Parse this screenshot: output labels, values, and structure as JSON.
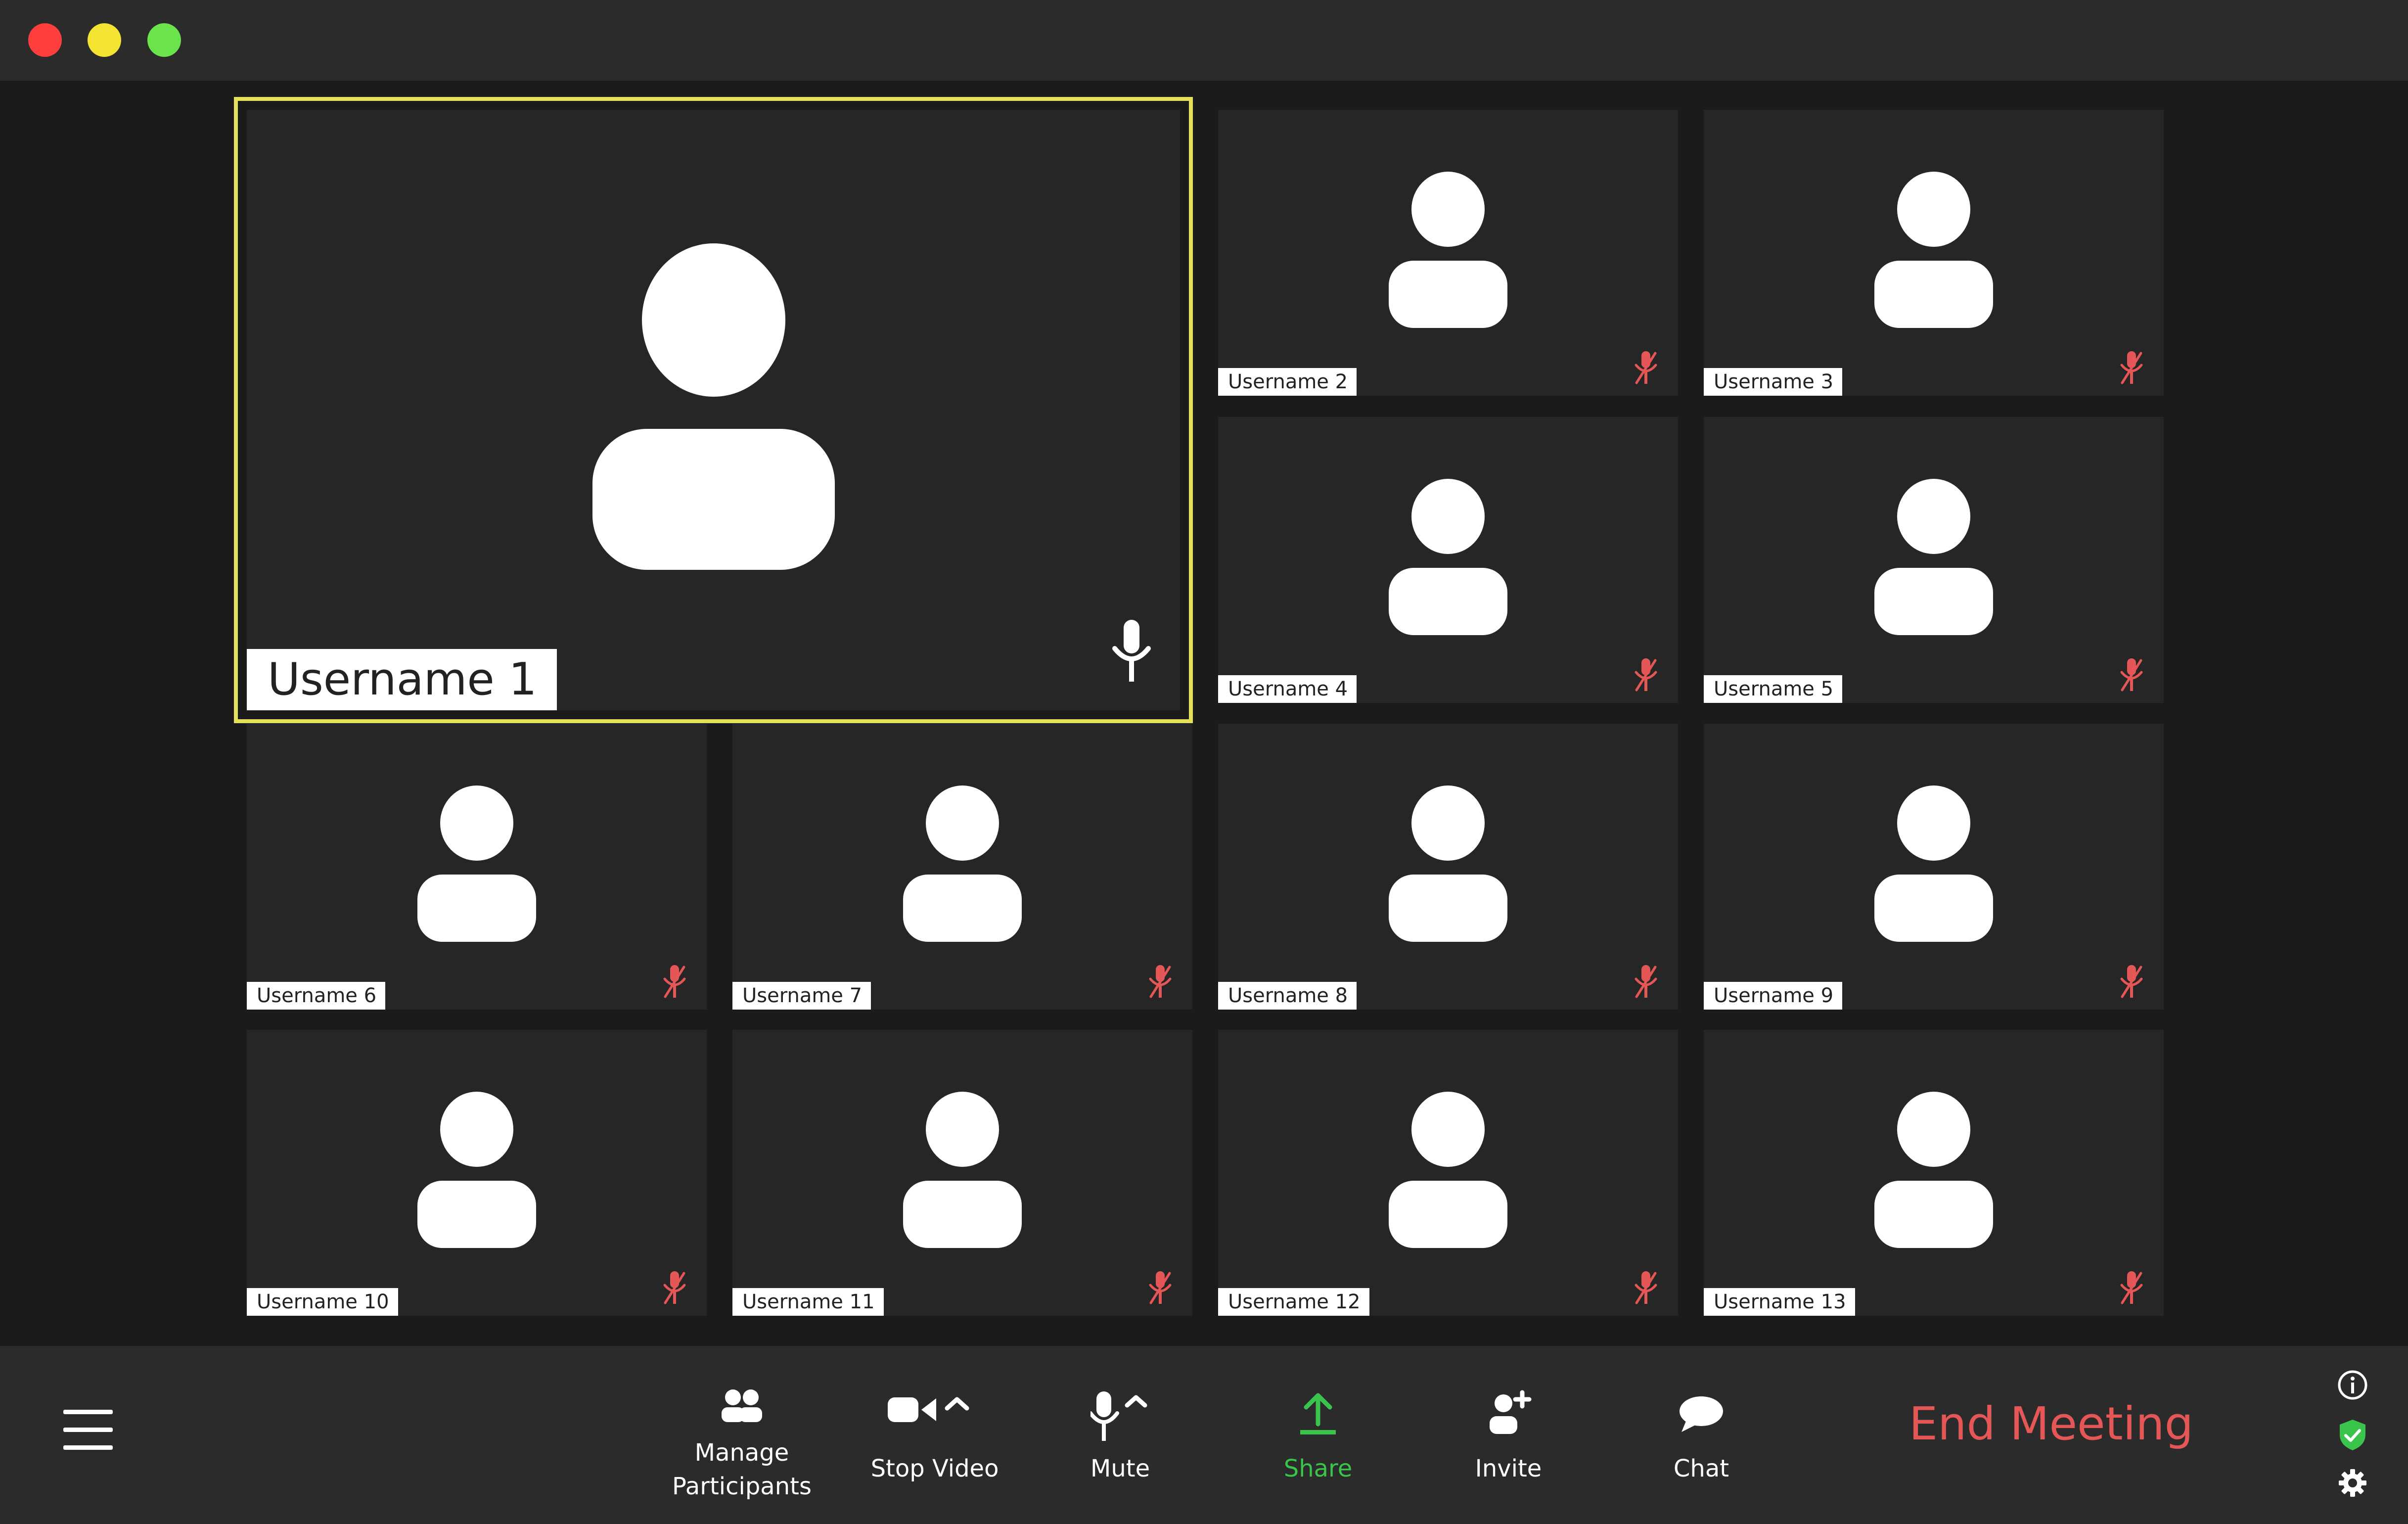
{
  "window": {
    "traffic_lights": {
      "close": "#fe3d3d",
      "minimize": "#f3e431",
      "maximize": "#6be44c"
    }
  },
  "participants": [
    {
      "name": "Username 1",
      "muted": false,
      "active_speaker": true
    },
    {
      "name": "Username 2",
      "muted": true
    },
    {
      "name": "Username 3",
      "muted": true
    },
    {
      "name": "Username 4",
      "muted": true
    },
    {
      "name": "Username 5",
      "muted": true
    },
    {
      "name": "Username 6",
      "muted": true
    },
    {
      "name": "Username 7",
      "muted": true
    },
    {
      "name": "Username 8",
      "muted": true
    },
    {
      "name": "Username 9",
      "muted": true
    },
    {
      "name": "Username 10",
      "muted": true
    },
    {
      "name": "Username 11",
      "muted": true
    },
    {
      "name": "Username 12",
      "muted": true
    },
    {
      "name": "Username 13",
      "muted": true
    }
  ],
  "toolbar": {
    "menu_icon": "hamburger-icon",
    "manage_participants_line1": "Manage",
    "manage_participants_line2": "Participants",
    "stop_video": "Stop Video",
    "mute": "Mute",
    "share": "Share",
    "invite": "Invite",
    "chat": "Chat",
    "end_meeting": "End Meeting"
  },
  "colors": {
    "active_speaker_border": "#e4e05a",
    "muted_mic": "#e55757",
    "share_accent": "#3bc44b",
    "end_meeting": "#e55757",
    "security_shield": "#3bc44b"
  },
  "side_icons": [
    "info-icon",
    "shield-check-icon",
    "gear-icon"
  ]
}
